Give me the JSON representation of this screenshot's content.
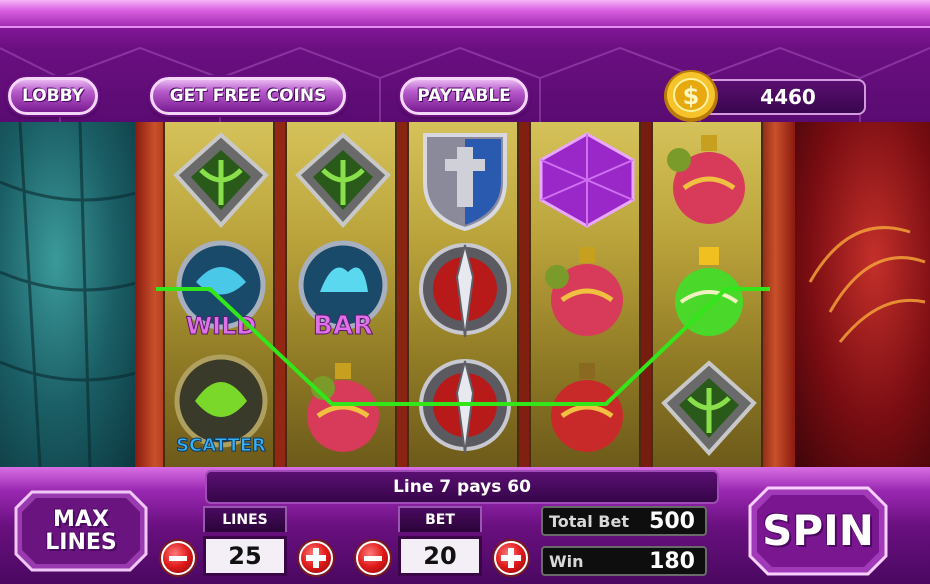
{
  "header": {
    "lobby_label": "LOBBY",
    "free_coins_label": "GET FREE COINS",
    "paytable_label": "PAYTABLE",
    "coin_balance": "4460"
  },
  "reels": [
    [
      "shield-rune-icon",
      "wild-dragon-icon",
      "scatter-dragon-icon"
    ],
    [
      "shield-rune-icon",
      "bar-griffin-icon",
      "potion-red-icon"
    ],
    [
      "armor-shield-icon",
      "sword-emblem-icon",
      "sword-emblem-icon"
    ],
    [
      "purple-gem-icon",
      "potion-red-icon",
      "potion-red-icon"
    ],
    [
      "potion-red-icon",
      "potion-green-icon",
      "shield-rune-icon"
    ]
  ],
  "symbol_text": {
    "wild": "WILD",
    "bar": "BAR",
    "scatter": "SCATTER"
  },
  "message": "Line 7 pays 60",
  "controls": {
    "max_lines_label_1": "MAX",
    "max_lines_label_2": "LINES",
    "lines_label": "LINES",
    "lines_value": "25",
    "bet_label": "BET",
    "bet_value": "20",
    "total_bet_label": "Total Bet",
    "total_bet_value": "500",
    "win_label": "Win",
    "win_value": "180",
    "spin_label": "SPIN"
  },
  "colors": {
    "payline": "#33e61a",
    "accent_purple": "#8a1aa0",
    "button_red": "#e01a1a"
  }
}
